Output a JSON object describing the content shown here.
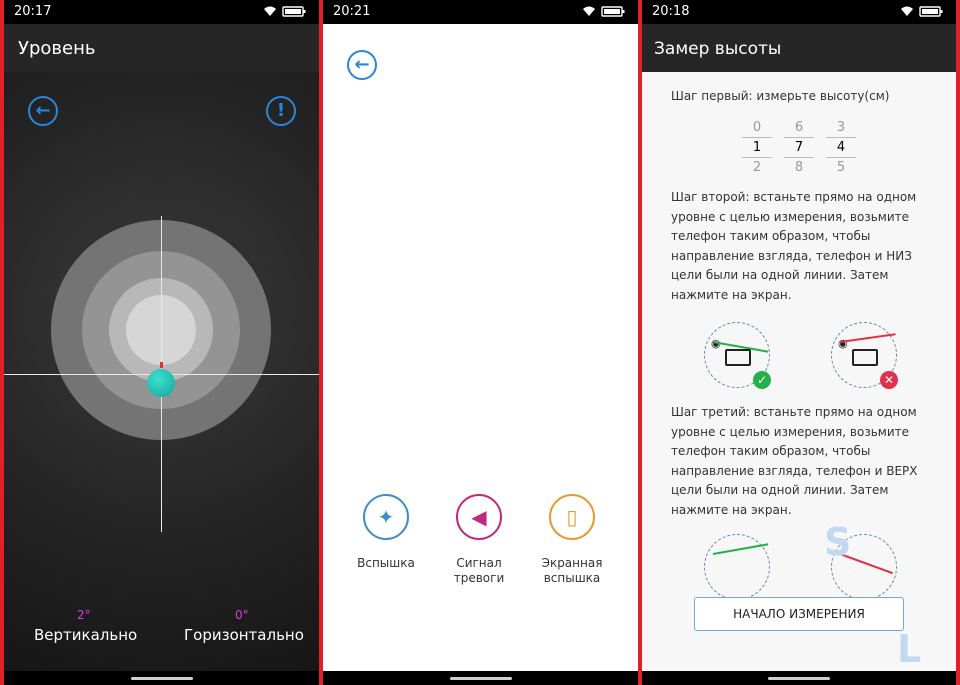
{
  "accent": "#2a86d6",
  "phone1": {
    "time": "20:17",
    "title": "Уровень",
    "back_icon": "arrow-left-icon",
    "info_icon": "exclamation-icon",
    "vertical_deg": "2°",
    "horizontal_deg": "0°",
    "vertical_label": "Вертикально",
    "horizontal_label": "Горизонтально"
  },
  "phone2": {
    "time": "20:21",
    "back_icon": "arrow-left-icon",
    "tools": [
      {
        "icon": "lightbulb-icon",
        "color": "#3d8ec9",
        "line1": "Вспышка",
        "line2": ""
      },
      {
        "icon": "speaker-icon",
        "color": "#c3287e",
        "line1": "Сигнал",
        "line2": "тревоги"
      },
      {
        "icon": "phone-flash-icon",
        "color": "#e59a2c",
        "line1": "Экранная",
        "line2": "вспышка"
      }
    ]
  },
  "phone3": {
    "time": "20:18",
    "title": "Замер высоты",
    "step1": "Шаг первый: измерьте высоту(см)",
    "picker": [
      {
        "above": "0",
        "selected": "1",
        "below": "2"
      },
      {
        "above": "6",
        "selected": "7",
        "below": "8"
      },
      {
        "above": "3",
        "selected": "4",
        "below": "5"
      }
    ],
    "step2": "Шаг второй: встаньте прямо на одном уровне с целью измерения, возьмите телефон таким образом, чтобы направление взгляда, телефон и НИЗ цели были на одной линии. Затем нажмите на экран.",
    "step3": "Шаг третий: встаньте прямо на одном уровне с целью измерения, возьмите телефон таким образом, чтобы направление взгляда, телефон и ВЕРХ цели были на одной линии. Затем нажмите на экран.",
    "ok_color": "#27b04a",
    "bad_color": "#e0304a",
    "start_button": "НАЧАЛО ИЗМЕРЕНИЯ",
    "watermark_s": "S",
    "watermark_l": "L"
  }
}
